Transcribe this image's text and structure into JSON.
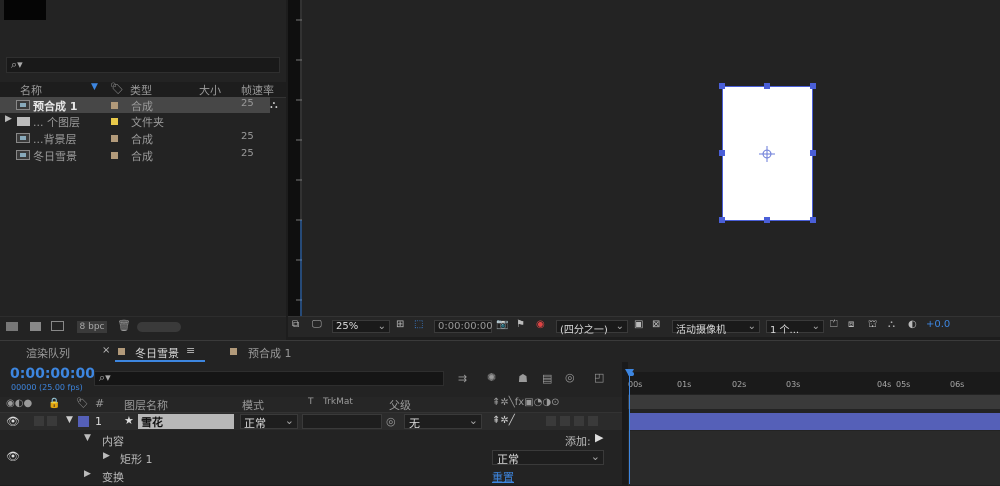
{
  "project": {
    "search_placeholder": "",
    "columns": {
      "name": "名称",
      "type": "类型",
      "size": "大小",
      "framerate": "帧速率"
    },
    "items": [
      {
        "name": "预合成 1",
        "type": "合成",
        "fps": "25",
        "selected": true,
        "kind": "comp",
        "label_color": "#b29a7a"
      },
      {
        "name": "... 个图层",
        "type": "文件夹",
        "fps": "",
        "selected": false,
        "kind": "folder",
        "label_color": "#e8c94a"
      },
      {
        "name": "...背景层",
        "type": "合成",
        "fps": "25",
        "selected": false,
        "kind": "comp",
        "label_color": "#b29a7a"
      },
      {
        "name": "冬日雪景",
        "type": "合成",
        "fps": "25",
        "selected": false,
        "kind": "comp",
        "label_color": "#b29a7a"
      }
    ],
    "footer_bpc": "8 bpc"
  },
  "viewer": {
    "zoom": "25%",
    "timecode": "0:00:00:00",
    "resolution": "(四分之一)",
    "camera": "活动摄像机",
    "views": "1 个...",
    "exposure": "+0.0"
  },
  "timeline": {
    "tabs": [
      {
        "label": "渲染队列",
        "active": false
      },
      {
        "label": "冬日雪景",
        "active": true
      },
      {
        "label": "预合成 1",
        "active": false
      }
    ],
    "timecode": "0:00:00:00",
    "fps": "00000 (25.00 fps)",
    "columns": {
      "num": "#",
      "layer_name": "图层名称",
      "mode": "模式",
      "t": "T",
      "trkmat": "TrkMat",
      "parent": "父级"
    },
    "layer": {
      "index": "1",
      "name": "雪花",
      "mode": "正常",
      "parent": "无"
    },
    "content_label": "内容",
    "add_label": "添加:",
    "rect_label": "矩形 1",
    "rect_mode": "正常",
    "transform_label": "变换",
    "reset_label": "重置",
    "ruler_ticks": [
      "00s",
      "01s",
      "02s",
      "03s",
      "04s",
      "05s",
      "06s"
    ]
  }
}
